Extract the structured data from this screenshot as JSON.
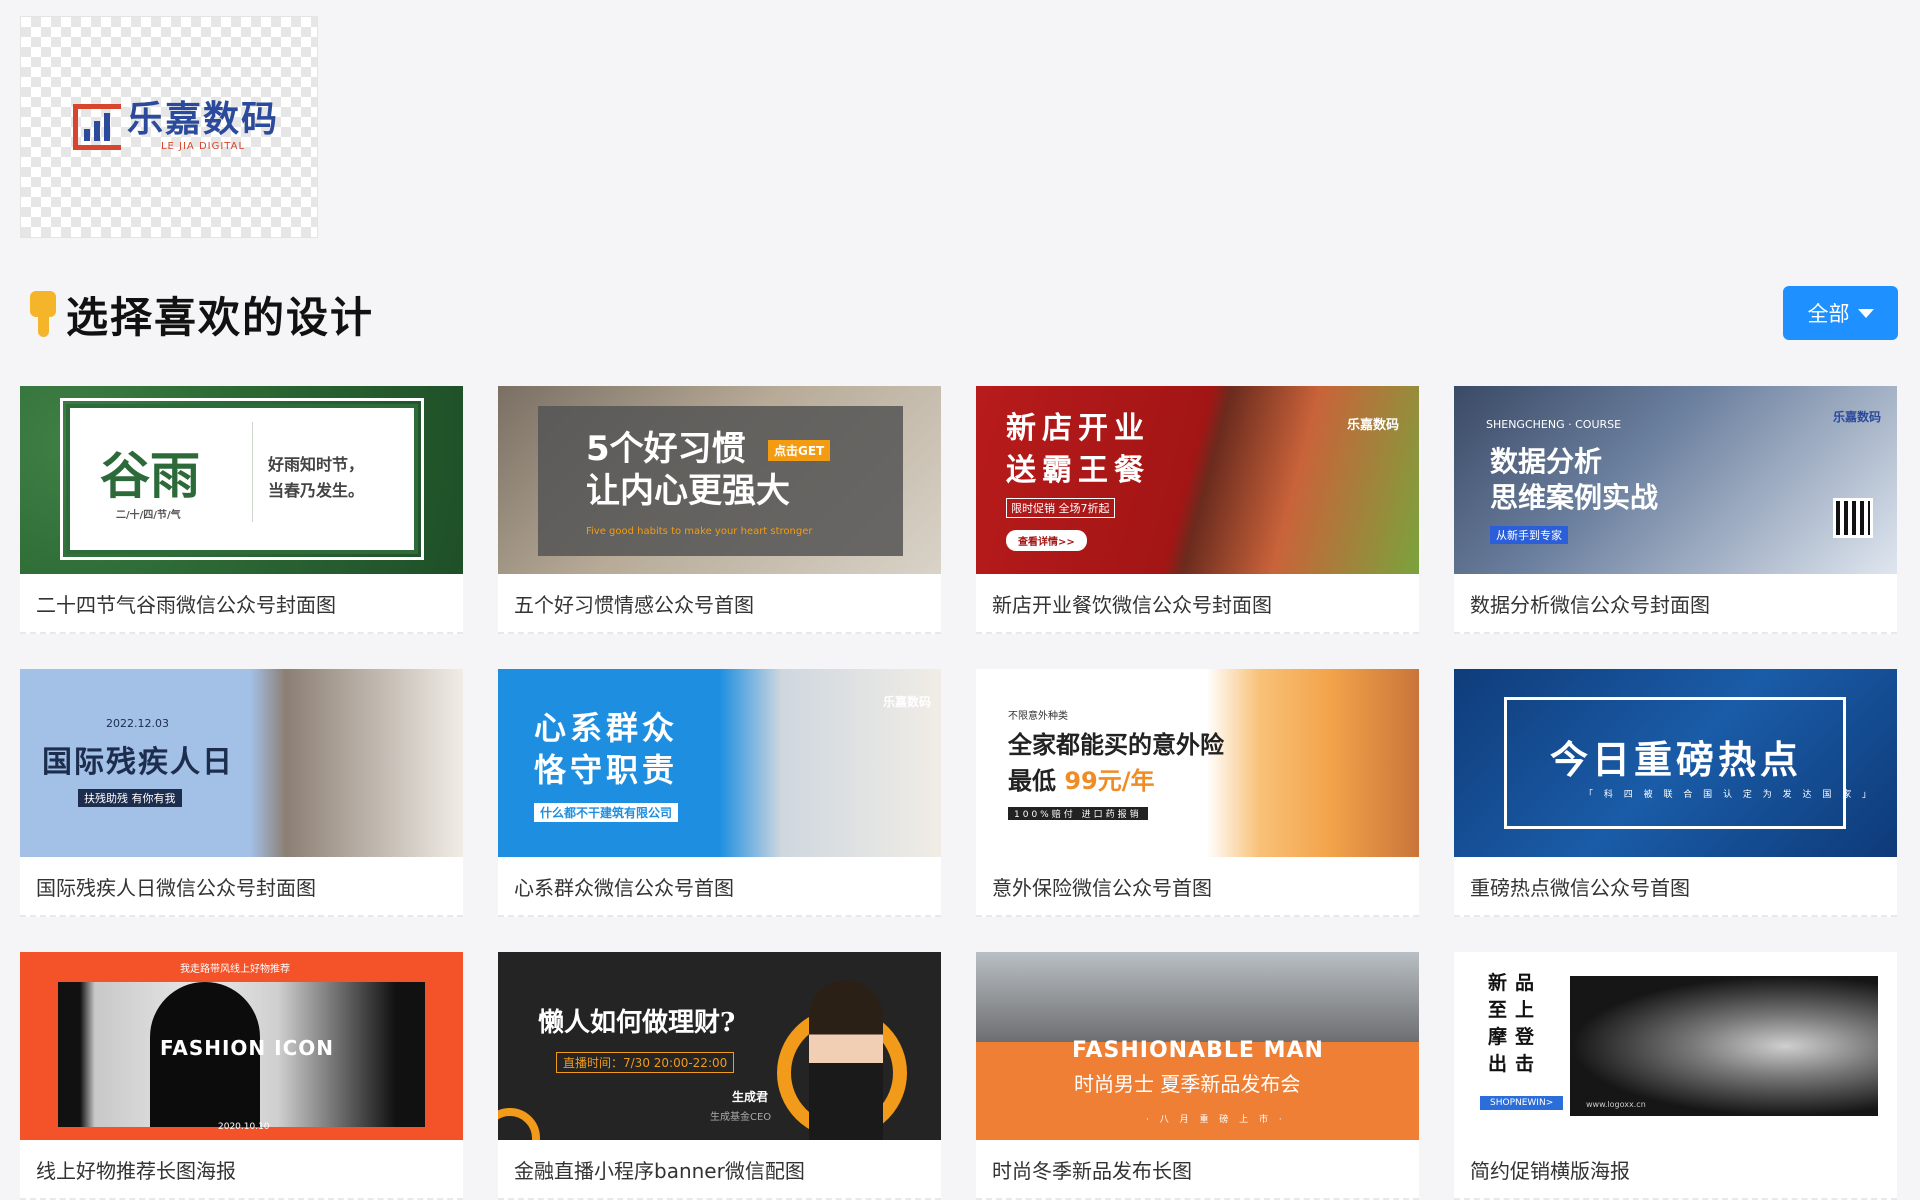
{
  "logo": {
    "name": "乐嘉数码",
    "subtitle": "LE JIA DIGITAL",
    "brand_color": "#2b4a9b",
    "accent_color": "#d8442c"
  },
  "section": {
    "title": "选择喜欢的设计",
    "icon": "pointing-down-hand-icon"
  },
  "filter": {
    "label": "全部",
    "icon": "caret-down-icon",
    "color": "#1e90ff"
  },
  "cards": [
    {
      "caption": "二十四节气谷雨微信公众号封面图",
      "big": "谷雨",
      "text": "好雨知时节，当春乃发生。",
      "sub": "二/十/四/节/气"
    },
    {
      "caption": "五个好习惯情感公众号首图",
      "big": "5个好习惯\n让内心更强大",
      "tag": "点击GET",
      "sub": "Five good habits to make your heart stronger"
    },
    {
      "caption": "新店开业餐饮微信公众号封面图",
      "big": "新店开业\n送霸王餐",
      "sub": "限时促销  全场7折起",
      "button": "查看详情>>",
      "brand": "乐嘉数码"
    },
    {
      "caption": "数据分析微信公众号封面图",
      "top": "SHENGCHENG · COURSE",
      "big": "数据分析\n思维案例实战",
      "tag": "从新手到专家",
      "brand": "乐嘉数码"
    },
    {
      "caption": "国际残疾人日微信公众号封面图",
      "date": "2022.12.03",
      "big": "国际残疾人日",
      "tag": "扶残助残 有你有我"
    },
    {
      "caption": "心系群众微信公众号首图",
      "big": "心系群众\n恪守职责",
      "tag": "什么都不干建筑有限公司",
      "brand": "乐嘉数码"
    },
    {
      "caption": "意外保险微信公众号首图",
      "top": "不限意外种类",
      "big": "全家都能买的意外险",
      "price_prefix": "最低 ",
      "price": "99元/年",
      "tag": "100%赔付 进口药报销"
    },
    {
      "caption": "重磅热点微信公众号首图",
      "big": "今日重磅热点",
      "sub": "「 科 四 被 联 合 国 认 定 为 发 达 国 家 」"
    },
    {
      "caption": "线上好物推荐长图海报",
      "top": "我走路带风线上好物推荐",
      "big": "FASHION ICON",
      "date": "2020.10.10"
    },
    {
      "caption": "金融直播小程序banner微信配图",
      "big": "懒人如何做理财?",
      "tag": "直播时间：7/30 20:00-22:00",
      "name": "生成君",
      "role": "生成基金CEO"
    },
    {
      "caption": "时尚冬季新品发布长图",
      "big": "FASHIONABLE MAN",
      "sub": "时尚男士 夏季新品发布会",
      "small": "· 八 月 重 磅 上 市 ·"
    },
    {
      "caption": "简约促销横版海报",
      "big": "新品至上 摩登出击",
      "tag": "SHOPNEWIN>",
      "url": "www.logoxx.cn"
    }
  ]
}
